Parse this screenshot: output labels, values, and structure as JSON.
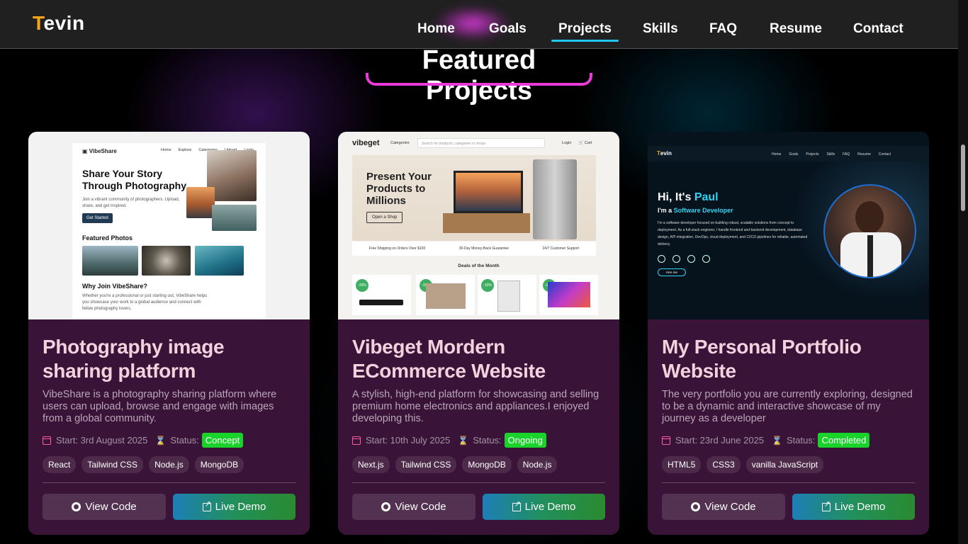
{
  "header": {
    "logo_initial": "T",
    "logo_rest": "evin",
    "nav": [
      "Home",
      "Goals",
      "Projects",
      "Skills",
      "FAQ",
      "Resume",
      "Contact"
    ],
    "active_nav": "Projects"
  },
  "section": {
    "title": "Featured Projects"
  },
  "colors": {
    "accent_cyan": "#21c9f0",
    "accent_pink": "#e83bd8",
    "card_bg": "#3a1338",
    "status_green": "#19d32b",
    "logo_orange": "#f7a61b"
  },
  "projects": [
    {
      "title": "Photography image sharing platform",
      "description": "VibeShare is a photography sharing platform where users can upload, browse and engage with images from a global community.",
      "start": "Start: 3rd August 2025",
      "status_label": "Status:",
      "status": "Concept",
      "tags": [
        "React",
        "Tailwind CSS",
        "Node.js",
        "MongoDB"
      ],
      "code_label": "View Code",
      "demo_label": "Live Demo",
      "preview": {
        "brand": "VibeShare",
        "nav": [
          "Home",
          "Explore",
          "Categories",
          "Upload",
          "Login"
        ],
        "hero": "Share Your Story Through Photography",
        "sub": "Join a vibrant community of photographers. Upload, share, and get inspired.",
        "cta": "Get Started",
        "featured": "Featured Photos",
        "why": "Why Join VibeShare?",
        "why_text": "Whether you're a professional or just starting out, VibeShare helps you showcase your work to a global audience and connect with fellow photography lovers."
      }
    },
    {
      "title": "Vibeget Mordern ECommerce Website",
      "description": "A stylish, high-end platform for showcasing and selling premium home electronics and appliances.I enjoyed developing this.",
      "start": "Start: 10th July 2025",
      "status_label": "Status:",
      "status": "Ongoing",
      "tags": [
        "Next.js",
        "Tailwind CSS",
        "MongoDB",
        "Node.js"
      ],
      "code_label": "View Code",
      "demo_label": "Live Demo",
      "preview": {
        "brand": "vibeget",
        "categories": "Categories",
        "search": "Search for products, categories or shops",
        "login": "Login",
        "cart": "Cart",
        "hero": "Present Your Products to Millions",
        "cta": "Open a Shop",
        "features": [
          "Free Shipping on Orders Over $100",
          "30-Day Money-Back Guarantee",
          "24/7 Customer Support"
        ],
        "deals": "Deals of the Month",
        "discounts": [
          "-20%",
          "-15%",
          "-10%",
          "-20%"
        ]
      }
    },
    {
      "title": "My Personal Portfolio Website",
      "description": "The very portfolio you are currently exploring, designed to be a dynamic and interactive showcase of my journey as a developer",
      "start": "Start: 23rd June 2025",
      "status_label": "Status:",
      "status": "Completed",
      "tags": [
        "HTML5",
        "CSS3",
        "vanilla JavaScript"
      ],
      "code_label": "View Code",
      "demo_label": "Live Demo",
      "preview": {
        "logo_initial": "T",
        "logo_rest": "evin",
        "nav": [
          "Home",
          "Goals",
          "Projects",
          "Skills",
          "FAQ",
          "Resume",
          "Contact"
        ],
        "greeting": "Hi, It's ",
        "name": "Paul",
        "role_prefix": "I'm a ",
        "role": "Software Developer",
        "bio": "I'm a software developer focused on building robust, scalable solutions from concept to deployment. As a full-stack engineer, I handle frontend and backend development, database design, API integration, DevOps, cloud deployment, and CI/CD pipelines for reliable, automated delivery.",
        "hire": "Hire me"
      }
    }
  ]
}
